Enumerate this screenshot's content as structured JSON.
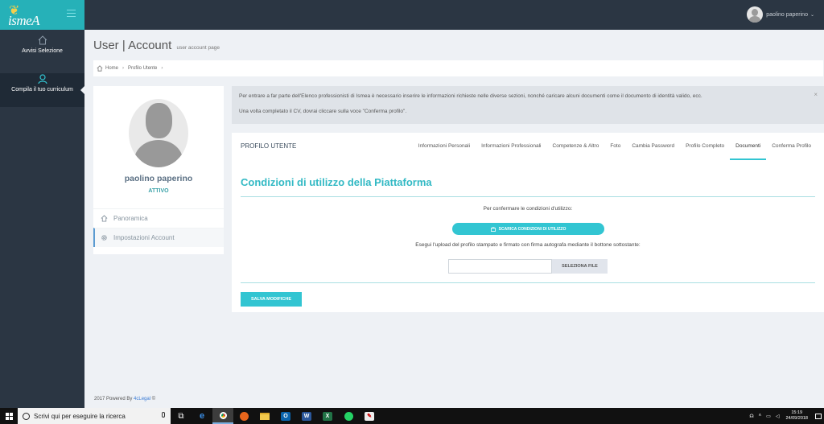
{
  "sidebar": {
    "logo_text": "ismeA",
    "items": [
      {
        "label": "Avvisi Selezione",
        "icon": "home-icon"
      },
      {
        "label": "Compila il tuo curriculum",
        "icon": "user-icon"
      }
    ],
    "footer_prefix": "2017 Powered By",
    "footer_link": "4cLegal",
    "footer_suffix": "©"
  },
  "topbar": {
    "username": "paolino paperino"
  },
  "page": {
    "title": "User | Account",
    "subtitle": "user account page"
  },
  "breadcrumb": [
    "Home",
    "Profilo Utente"
  ],
  "profile": {
    "name": "paolino paperino",
    "status": "ATTIVO",
    "menu": [
      {
        "label": "Panoramica",
        "icon": "home-icon"
      },
      {
        "label": "Impostazioni Account",
        "icon": "gear-icon"
      }
    ]
  },
  "alert": {
    "line1": "Per entrare a far parte dell'Elenco professionisti di Ismea è necessario inserire le informazioni richieste nelle diverse sezioni, nonché caricare alcuni documenti come il documento di identità valido, ecc.",
    "line2": "Una volta completato il CV, dovrai cliccare sulla voce \"Conferma profilo\".",
    "close": "×"
  },
  "panel": {
    "caption": "PROFILO UTENTE",
    "tabs": [
      "Informazioni Personali",
      "Informazioni Professionali",
      "Competenze & Altro",
      "Foto",
      "Cambia Password",
      "Profilo Completo",
      "Documenti",
      "Conferma Profilo"
    ],
    "active_tab": "Documenti",
    "section_title": "Condizioni di utilizzo della Piattaforma",
    "confirm_text": "Per confermare le condizioni d'utilizzo:",
    "download_label": "SCARICA CONDIZIONI DI UTILIZZO",
    "upload_text": "Esegui l'upload del profilo stampato e firmato con firma autografa mediante il bottone sottostante:",
    "file_value": "",
    "select_file_label": "SELEZIONA FILE",
    "save_label": "SALVA MODIFICHE"
  },
  "taskbar": {
    "search_placeholder": "Scrivi qui per eseguire la ricerca",
    "time": "15:19",
    "date": "24/09/2018"
  },
  "colors": {
    "accent": "#32c5d2",
    "sidebar": "#2b3643",
    "logo_bg": "#26b1b8"
  }
}
